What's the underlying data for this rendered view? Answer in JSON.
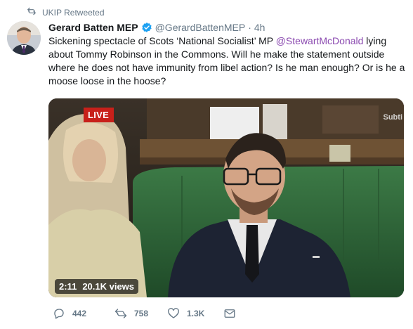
{
  "retweet": {
    "label": "UKIP Retweeted"
  },
  "author": {
    "name": "Gerard Batten MEP",
    "handle": "@GerardBattenMEP",
    "separator": "·",
    "time": "4h"
  },
  "tweet": {
    "text_before": "Sickening spectacle of Scots ‘National Socialist’ MP ",
    "mention": "@StewartMcDonald",
    "text_after": " lying about Tommy Robinson in the Commons. Will he make the statement outside where he does not have immunity from libel action? Is he man enough? Or is he a moose loose in the hoose?"
  },
  "media": {
    "live_label": "LIVE",
    "corner_text": "Subti",
    "duration": "2:11",
    "views": "20.1K views"
  },
  "actions": {
    "replies": "442",
    "retweets": "758",
    "likes": "1.3K"
  },
  "colors": {
    "mention": "#8b4ab0",
    "verified": "#1da1f2",
    "live": "#c8201a",
    "bench_green": "#2e6b3a"
  },
  "icons": [
    "retweet-icon",
    "verified-badge-icon",
    "reply-icon",
    "like-icon",
    "message-icon"
  ]
}
